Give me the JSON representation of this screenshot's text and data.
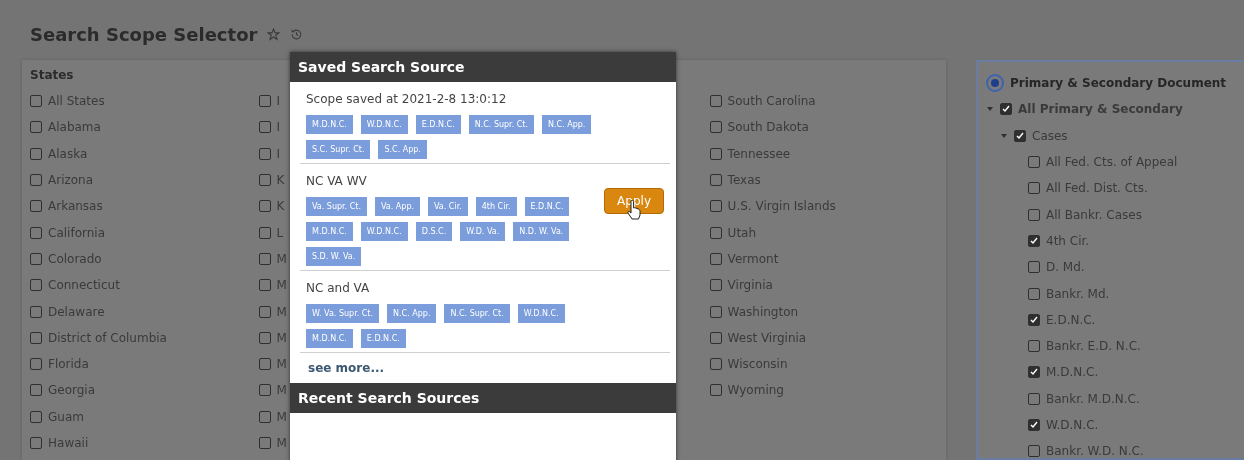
{
  "header": {
    "title": "Search Scope Selector"
  },
  "states": {
    "heading": "States",
    "columns": [
      [
        {
          "label": "All States",
          "checked": false
        },
        {
          "label": "Alabama",
          "checked": false
        },
        {
          "label": "Alaska",
          "checked": false
        },
        {
          "label": "Arizona",
          "checked": false
        },
        {
          "label": "Arkansas",
          "checked": false
        },
        {
          "label": "California",
          "checked": false
        },
        {
          "label": "Colorado",
          "checked": false
        },
        {
          "label": "Connecticut",
          "checked": false
        },
        {
          "label": "Delaware",
          "checked": false
        },
        {
          "label": "District of Columbia",
          "checked": false
        },
        {
          "label": "Florida",
          "checked": false
        },
        {
          "label": "Georgia",
          "checked": false
        },
        {
          "label": "Guam",
          "checked": false
        },
        {
          "label": "Hawaii",
          "checked": false
        }
      ],
      [
        {
          "label": "I",
          "checked": false
        },
        {
          "label": "I",
          "checked": false
        },
        {
          "label": "I",
          "checked": false
        },
        {
          "label": "K",
          "checked": false
        },
        {
          "label": "K",
          "checked": false
        },
        {
          "label": "L",
          "checked": false
        },
        {
          "label": "M",
          "checked": false
        },
        {
          "label": "M",
          "checked": false
        },
        {
          "label": "M",
          "checked": false
        },
        {
          "label": "M",
          "checked": false
        },
        {
          "label": "M",
          "checked": false
        },
        {
          "label": "M",
          "checked": false
        },
        {
          "label": "M",
          "checked": false
        },
        {
          "label": "M",
          "checked": false
        }
      ],
      [
        {
          "label": "South Carolina",
          "checked": false
        },
        {
          "label": "South Dakota",
          "checked": false
        },
        {
          "label": "Tennessee",
          "checked": false
        },
        {
          "label": "Texas",
          "checked": false
        },
        {
          "label": "U.S. Virgin Islands",
          "checked": false
        },
        {
          "label": "Utah",
          "checked": false
        },
        {
          "label": "Vermont",
          "checked": false
        },
        {
          "label": "Virginia",
          "checked": false
        },
        {
          "label": "Washington",
          "checked": false
        },
        {
          "label": "West Virginia",
          "checked": false
        },
        {
          "label": "Wisconsin",
          "checked": false
        },
        {
          "label": "Wyoming",
          "checked": false
        }
      ]
    ]
  },
  "popup": {
    "title": "Saved Search Source",
    "sources": [
      {
        "name": "Scope saved at 2021-2-8 13:0:12",
        "tags": [
          "M.D.N.C.",
          "W.D.N.C.",
          "E.D.N.C.",
          "N.C. Supr. Ct.",
          "N.C. App.",
          "S.C. Supr. Ct.",
          "S.C. App."
        ]
      },
      {
        "name": "NC VA WV",
        "tags": [
          "Va. Supr. Ct.",
          "Va. App.",
          "Va. Cir.",
          "4th Cir.",
          "E.D.N.C.",
          "M.D.N.C.",
          "W.D.N.C.",
          "D.S.C.",
          "W.D. Va.",
          "N.D. W. Va.",
          "S.D. W. Va."
        ],
        "apply_button": "Apply"
      },
      {
        "name": "NC and VA",
        "tags": [
          "W. Va. Supr. Ct.",
          "N.C. App.",
          "N.C. Supr. Ct.",
          "W.D.N.C.",
          "M.D.N.C.",
          "E.D.N.C."
        ]
      }
    ],
    "see_more": "see more...",
    "recent_title": "Recent Search Sources"
  },
  "documents": {
    "label": "Primary & Secondary Document",
    "selected": true,
    "tree": [
      {
        "label": "All Primary & Secondary",
        "checked": true,
        "expanded": true,
        "children": [
          {
            "label": "Cases",
            "checked": true,
            "expanded": true,
            "children": [
              {
                "label": "All Fed. Cts. of Appeal",
                "checked": false
              },
              {
                "label": "All Fed. Dist. Cts.",
                "checked": false
              },
              {
                "label": "All Bankr. Cases",
                "checked": false
              },
              {
                "label": "4th Cir.",
                "checked": true
              },
              {
                "label": "D. Md.",
                "checked": false
              },
              {
                "label": "Bankr. Md.",
                "checked": false
              },
              {
                "label": "E.D.N.C.",
                "checked": true
              },
              {
                "label": "Bankr. E.D. N.C.",
                "checked": false
              },
              {
                "label": "M.D.N.C.",
                "checked": true
              },
              {
                "label": "Bankr. M.D.N.C.",
                "checked": false
              },
              {
                "label": "W.D.N.C.",
                "checked": true
              },
              {
                "label": "Bankr. W.D. N.C.",
                "checked": false
              }
            ]
          }
        ]
      }
    ]
  }
}
